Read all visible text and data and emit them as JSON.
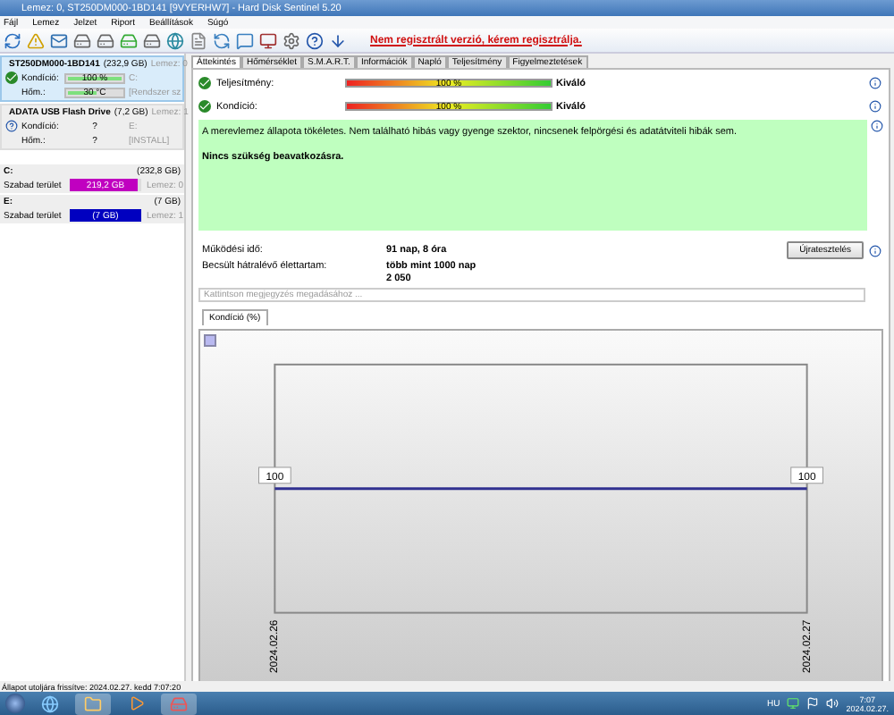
{
  "window": {
    "title": "Lemez: 0, ST250DM000-1BD141 [9VYERHW7]  -  Hard Disk Sentinel 5.20"
  },
  "menu": [
    "Fájl",
    "Lemez",
    "Jelzet",
    "Riport",
    "Beállítások",
    "Súgó"
  ],
  "banner": "Nem regisztrált verzió, kérem regisztrálja.",
  "disks": [
    {
      "name": "ST250DM000-1BD141",
      "size": "(232,9 GB)",
      "index": "Lemez: 0",
      "selected": true,
      "condition_known": true,
      "rows": [
        {
          "label": "Kondíció:",
          "value": "100 %",
          "level": 1,
          "extra": "C:"
        },
        {
          "label": "Hőm.:",
          "value": "30 °C",
          "level": 0.5,
          "extra": "[Rendszer sz"
        }
      ]
    },
    {
      "name": "ADATA  USB Flash Drive",
      "size": "(7,2 GB)",
      "index": "Lemez: 1",
      "selected": false,
      "condition_known": false,
      "rows": [
        {
          "label": "Kondíció:",
          "value": "?",
          "extra": "E:"
        },
        {
          "label": "Hőm.:",
          "value": "?",
          "extra": "[INSTALL]"
        }
      ]
    }
  ],
  "volumes": [
    {
      "letter": "C:",
      "size": "(232,8 GB)",
      "label": "Szabad terület",
      "free": "219,2 GB",
      "level": 0.94,
      "color": "#c000c0",
      "disk": "Lemez: 0"
    },
    {
      "letter": "E:",
      "size": "(7 GB)",
      "label": "Szabad terület",
      "free": "(7 GB)",
      "level": 1,
      "color": "#0000c0",
      "disk": "Lemez: 1"
    }
  ],
  "tabs": [
    {
      "label": "Áttekintés",
      "selected": true
    },
    {
      "label": "Hőmérséklet",
      "selected": false
    },
    {
      "label": "S.M.A.R.T.",
      "selected": false
    },
    {
      "label": "Információk",
      "selected": false
    },
    {
      "label": "Napló",
      "selected": false
    },
    {
      "label": "Teljesítmény",
      "selected": false
    },
    {
      "label": "Figyelmeztetések",
      "selected": false
    }
  ],
  "meters": [
    {
      "label": "Teljesítmény:",
      "value": "100 %",
      "level": 1,
      "rating": "Kiváló"
    },
    {
      "label": "Kondíció:",
      "value": "100 %",
      "level": 1,
      "rating": "Kiváló"
    }
  ],
  "message": {
    "text": "A merevlemez állapota tökéletes. Nem található hibás vagy gyenge szektor, nincsenek felpörgési és adatátviteli hibák sem.",
    "note": "Nincs szükség beavatkozásra."
  },
  "stats": [
    {
      "label": "Működési idő:",
      "value": "91 nap, 8 óra"
    },
    {
      "label": "Becsült hátralévő élettartam:",
      "value": "több mint 1000 nap"
    },
    {
      "value": "2 050"
    }
  ],
  "retest_button": "Újratesztelés",
  "comment": {
    "placeholder": "Kattintson megjegyzés megadásához ..."
  },
  "chart_tab": "Kondíció (%)",
  "chart": {
    "points": [
      {
        "date": "2024.02.26",
        "label": "100"
      },
      {
        "date": "2024.02.27",
        "label": "100"
      }
    ]
  },
  "status_bar": "Állapot utoljára frissítve: 2024.02.27. kedd 7:07:20",
  "taskbar": {
    "language": "HU",
    "time": "7:07",
    "date": "2024.02.27."
  }
}
